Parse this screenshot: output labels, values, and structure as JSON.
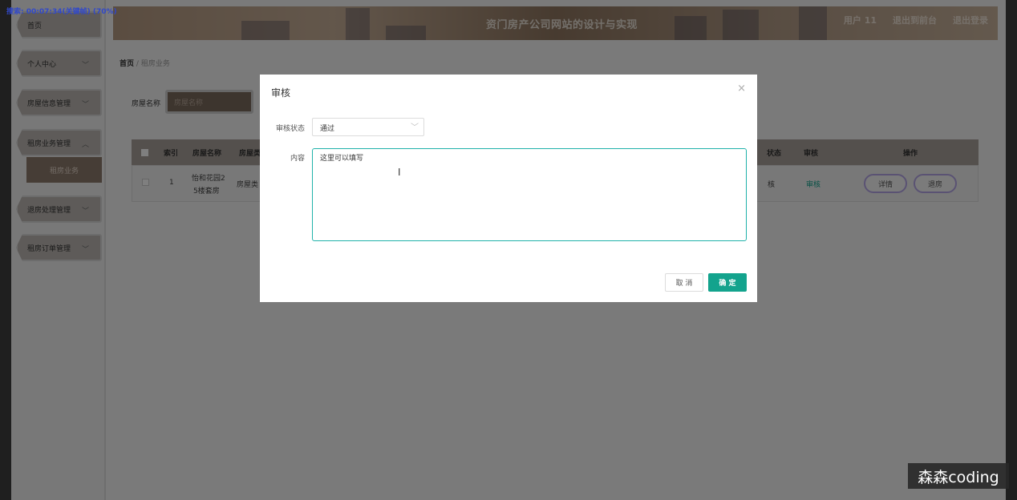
{
  "recording": {
    "status": "搜索: 00:07:34(关键帧) (70%)"
  },
  "header": {
    "title": "资门房产公司网站的设计与实现",
    "user": "用户 11",
    "back_to_front": "退出到前台",
    "logout": "退出登录"
  },
  "sidebar": {
    "items": [
      {
        "label": "首页"
      },
      {
        "label": "个人中心"
      },
      {
        "label": "房屋信息管理"
      },
      {
        "label": "租房业务管理"
      },
      {
        "label": "退房处理管理"
      },
      {
        "label": "租房订单管理"
      }
    ],
    "sub_item": "租房业务"
  },
  "breadcrumb": {
    "home": "首页",
    "sep": "/",
    "current": "租房业务"
  },
  "search": {
    "label": "房屋名称",
    "placeholder": "房屋名称"
  },
  "table": {
    "headers": [
      "索引",
      "房屋名称",
      "房屋类",
      "状态",
      "审核",
      "操作"
    ],
    "row": {
      "index": "1",
      "name_line1": "怡和花园2",
      "name_line2": "5楼套房",
      "type": "房屋类",
      "status": "核",
      "audit": "审核",
      "detail_btn": "详情",
      "checkout_btn": "退房"
    }
  },
  "dialog": {
    "title": "审核",
    "close": "×",
    "status_label": "审核状态",
    "status_value": "通过",
    "content_label": "内容",
    "content_value": "这里可以填写",
    "cancel": "取 消",
    "confirm": "确 定"
  },
  "watermark": "森森coding"
}
